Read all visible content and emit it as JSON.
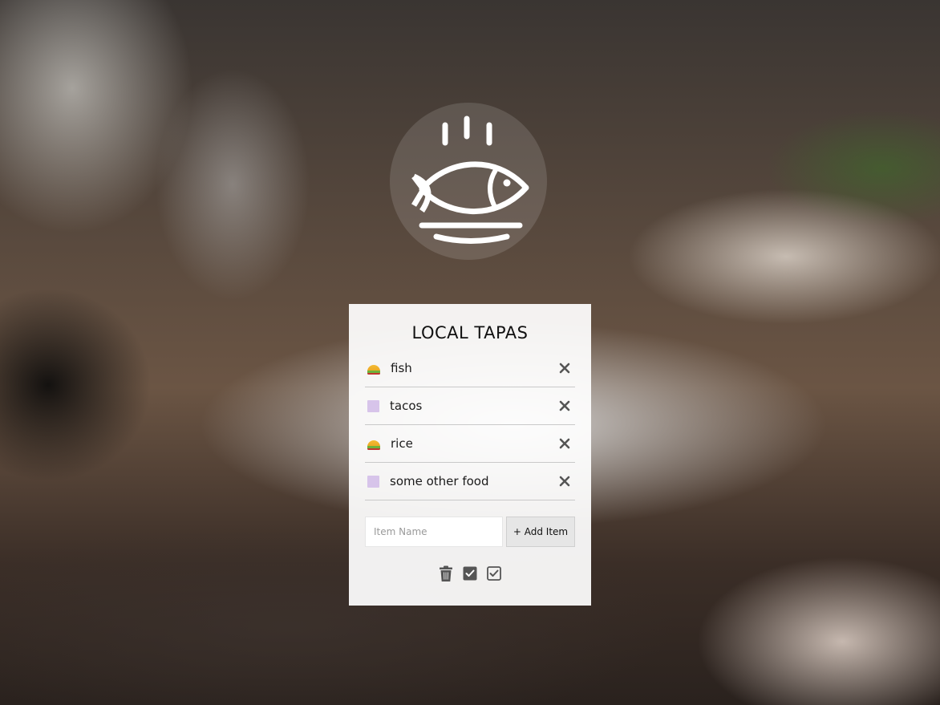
{
  "app": {
    "title": "LOCAL TAPAS",
    "logo_icon": "fish-on-plate-icon"
  },
  "list": {
    "items": [
      {
        "label": "fish",
        "icon": "taco-icon",
        "remove_icon": "close-icon"
      },
      {
        "label": "tacos",
        "icon": "lavender-square-icon",
        "remove_icon": "close-icon"
      },
      {
        "label": "rice",
        "icon": "taco-icon",
        "remove_icon": "close-icon"
      },
      {
        "label": "some other food",
        "icon": "lavender-square-icon",
        "remove_icon": "close-icon"
      }
    ]
  },
  "add_form": {
    "input_value": "",
    "input_placeholder": "Item Name",
    "button_label": "+ Add Item"
  },
  "toolbar": {
    "icons": [
      "trash-icon",
      "checkbox-checked-filled-icon",
      "checkbox-checked-outline-icon"
    ]
  },
  "colors": {
    "card_background": "#ffffff",
    "title_text": "#111111",
    "remove_icon": "#555555",
    "lavender_square": "#d7c4ea",
    "taco_shell": "#f4bb34",
    "button_background": "#e6e6e6"
  }
}
